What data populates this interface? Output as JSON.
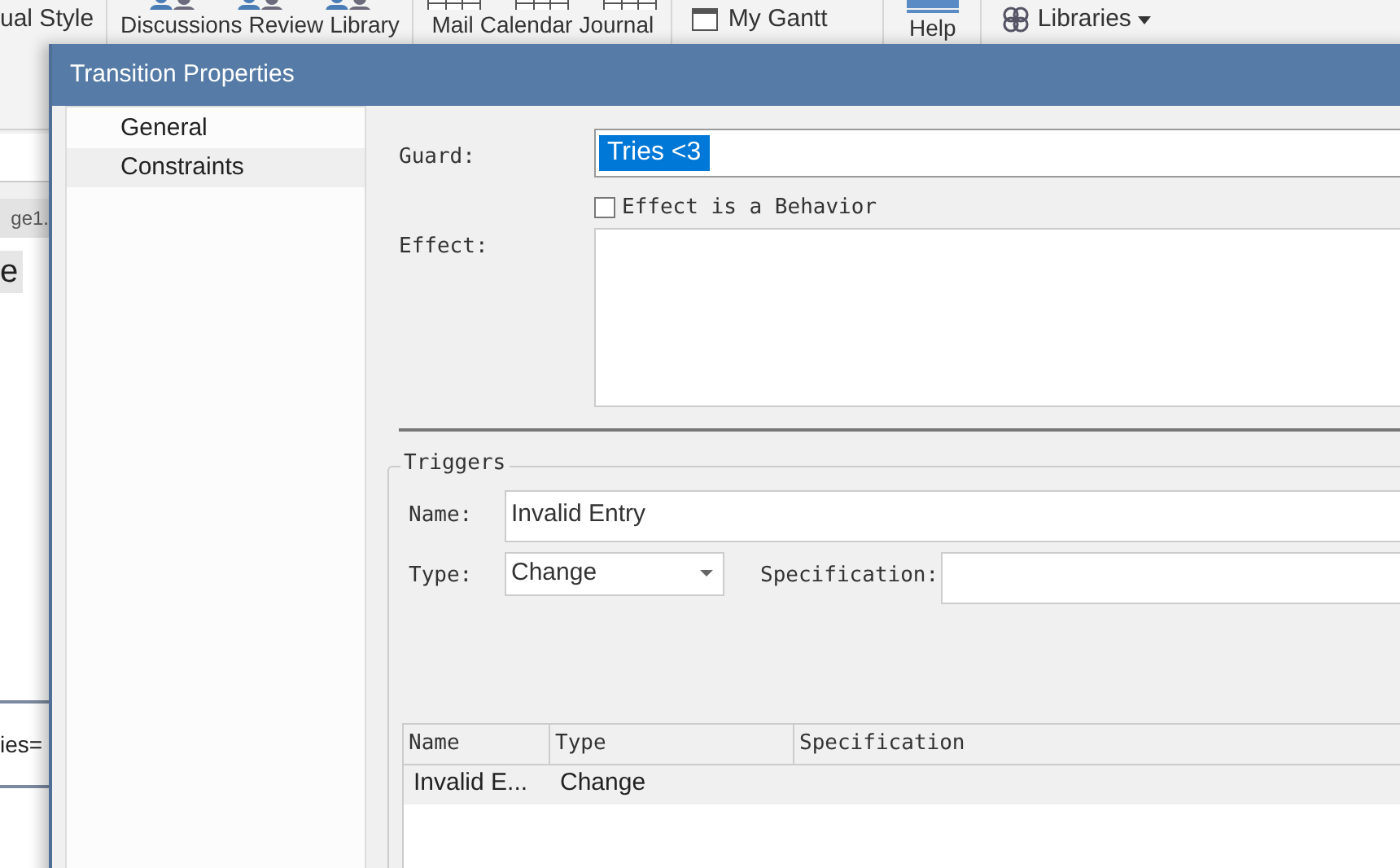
{
  "background_app": {
    "ribbon": {
      "visual_style": "ual Style",
      "groups": [
        {
          "items": [
            "Discussions",
            "Review",
            "Library"
          ]
        },
        {
          "items": [
            "Mail",
            "Calendar",
            "Journal"
          ]
        }
      ],
      "my_gantt": "My Gantt",
      "help": "Help",
      "libraries": "Libraries"
    },
    "tab": "ge1.",
    "button": "e",
    "text": "ies="
  },
  "dialog": {
    "title": "Transition Properties",
    "nav": [
      {
        "label": "General",
        "selected": false
      },
      {
        "label": "Constraints",
        "selected": true
      }
    ],
    "guard": {
      "label": "Guard:",
      "value": "Tries <3",
      "text_selected": true
    },
    "effect_is_behavior": {
      "label": "Effect is a Behavior",
      "checked": false
    },
    "effect": {
      "label": "Effect:"
    },
    "triggers": {
      "title": "Triggers",
      "name_label": "Name:",
      "name_value": "Invalid Entry",
      "type_label": "Type:",
      "type_value": "Change",
      "spec_label": "Specification:",
      "table": {
        "columns": [
          "Name",
          "Type",
          "Specification"
        ],
        "rows": [
          {
            "cells": [
              "Invalid E...",
              "Change",
              ""
            ],
            "selected": true
          }
        ]
      }
    }
  }
}
